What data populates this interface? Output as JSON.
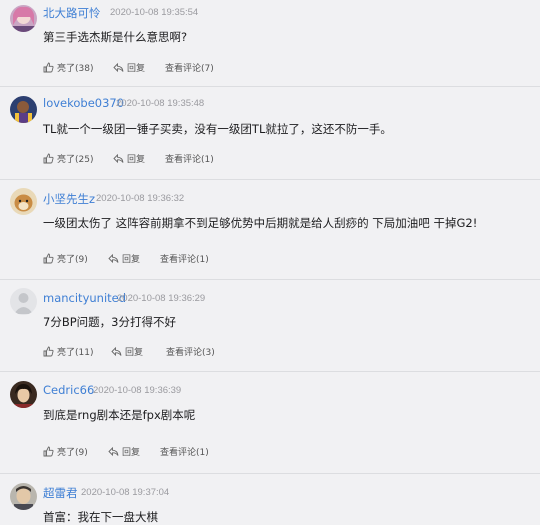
{
  "icons": {
    "like": "thumbs-up-icon",
    "reply": "reply-arrow-icon"
  },
  "colors": {
    "username": "#3f7fd4",
    "timestamp": "#9a9a9f",
    "background": "#f1f1f3"
  },
  "comments": [
    {
      "user": "北大路可怜",
      "time": "2020-10-08 19:35:54",
      "text": "第三手选杰斯是什么意思啊?",
      "like": "亮了(38)",
      "reply": "回复",
      "view": "查看评论(7)"
    },
    {
      "user": "lovekobe0370",
      "time": "2020-10-08 19:35:48",
      "text": "TL就一个一级团一锤子买卖，没有一级团TL就拉了，这还不防一手。",
      "like": "亮了(25)",
      "reply": "回复",
      "view": "查看评论(1)"
    },
    {
      "user": "小坚先生z",
      "time": "2020-10-08 19:36:32",
      "text": "一级团太伤了 这阵容前期拿不到足够优势中后期就是给人刮痧的 下局加油吧 干掉G2!",
      "like": "亮了(9)",
      "reply": "回复",
      "view": "查看评论(1)"
    },
    {
      "user": "mancityunited",
      "time": "2020-10-08 19:36:29",
      "text": "7分BP问题，3分打得不好",
      "like": "亮了(11)",
      "reply": "回复",
      "view": "查看评论(3)"
    },
    {
      "user": "Cedric66",
      "time": "2020-10-08 19:36:39",
      "text": "到底是rng剧本还是fpx剧本呢",
      "like": "亮了(9)",
      "reply": "回复",
      "view": "查看评论(1)"
    },
    {
      "user": "超雷君",
      "time": "2020-10-08 19:37:04",
      "text": "首富：我在下一盘大棋"
    }
  ]
}
